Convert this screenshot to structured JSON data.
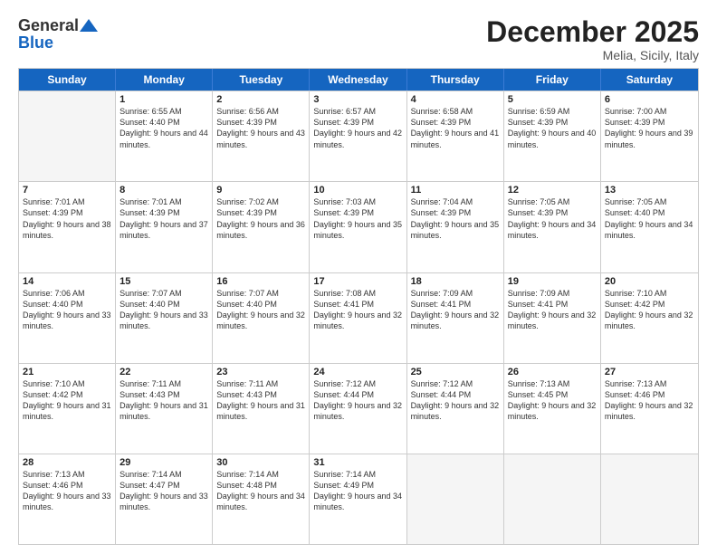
{
  "logo": {
    "line1": "General",
    "line2": "Blue"
  },
  "header": {
    "title": "December 2025",
    "subtitle": "Melia, Sicily, Italy"
  },
  "weekdays": [
    "Sunday",
    "Monday",
    "Tuesday",
    "Wednesday",
    "Thursday",
    "Friday",
    "Saturday"
  ],
  "rows": [
    [
      {
        "day": "",
        "sunrise": "",
        "sunset": "",
        "daylight": ""
      },
      {
        "day": "1",
        "sunrise": "Sunrise: 6:55 AM",
        "sunset": "Sunset: 4:40 PM",
        "daylight": "Daylight: 9 hours and 44 minutes."
      },
      {
        "day": "2",
        "sunrise": "Sunrise: 6:56 AM",
        "sunset": "Sunset: 4:39 PM",
        "daylight": "Daylight: 9 hours and 43 minutes."
      },
      {
        "day": "3",
        "sunrise": "Sunrise: 6:57 AM",
        "sunset": "Sunset: 4:39 PM",
        "daylight": "Daylight: 9 hours and 42 minutes."
      },
      {
        "day": "4",
        "sunrise": "Sunrise: 6:58 AM",
        "sunset": "Sunset: 4:39 PM",
        "daylight": "Daylight: 9 hours and 41 minutes."
      },
      {
        "day": "5",
        "sunrise": "Sunrise: 6:59 AM",
        "sunset": "Sunset: 4:39 PM",
        "daylight": "Daylight: 9 hours and 40 minutes."
      },
      {
        "day": "6",
        "sunrise": "Sunrise: 7:00 AM",
        "sunset": "Sunset: 4:39 PM",
        "daylight": "Daylight: 9 hours and 39 minutes."
      }
    ],
    [
      {
        "day": "7",
        "sunrise": "Sunrise: 7:01 AM",
        "sunset": "Sunset: 4:39 PM",
        "daylight": "Daylight: 9 hours and 38 minutes."
      },
      {
        "day": "8",
        "sunrise": "Sunrise: 7:01 AM",
        "sunset": "Sunset: 4:39 PM",
        "daylight": "Daylight: 9 hours and 37 minutes."
      },
      {
        "day": "9",
        "sunrise": "Sunrise: 7:02 AM",
        "sunset": "Sunset: 4:39 PM",
        "daylight": "Daylight: 9 hours and 36 minutes."
      },
      {
        "day": "10",
        "sunrise": "Sunrise: 7:03 AM",
        "sunset": "Sunset: 4:39 PM",
        "daylight": "Daylight: 9 hours and 35 minutes."
      },
      {
        "day": "11",
        "sunrise": "Sunrise: 7:04 AM",
        "sunset": "Sunset: 4:39 PM",
        "daylight": "Daylight: 9 hours and 35 minutes."
      },
      {
        "day": "12",
        "sunrise": "Sunrise: 7:05 AM",
        "sunset": "Sunset: 4:39 PM",
        "daylight": "Daylight: 9 hours and 34 minutes."
      },
      {
        "day": "13",
        "sunrise": "Sunrise: 7:05 AM",
        "sunset": "Sunset: 4:40 PM",
        "daylight": "Daylight: 9 hours and 34 minutes."
      }
    ],
    [
      {
        "day": "14",
        "sunrise": "Sunrise: 7:06 AM",
        "sunset": "Sunset: 4:40 PM",
        "daylight": "Daylight: 9 hours and 33 minutes."
      },
      {
        "day": "15",
        "sunrise": "Sunrise: 7:07 AM",
        "sunset": "Sunset: 4:40 PM",
        "daylight": "Daylight: 9 hours and 33 minutes."
      },
      {
        "day": "16",
        "sunrise": "Sunrise: 7:07 AM",
        "sunset": "Sunset: 4:40 PM",
        "daylight": "Daylight: 9 hours and 32 minutes."
      },
      {
        "day": "17",
        "sunrise": "Sunrise: 7:08 AM",
        "sunset": "Sunset: 4:41 PM",
        "daylight": "Daylight: 9 hours and 32 minutes."
      },
      {
        "day": "18",
        "sunrise": "Sunrise: 7:09 AM",
        "sunset": "Sunset: 4:41 PM",
        "daylight": "Daylight: 9 hours and 32 minutes."
      },
      {
        "day": "19",
        "sunrise": "Sunrise: 7:09 AM",
        "sunset": "Sunset: 4:41 PM",
        "daylight": "Daylight: 9 hours and 32 minutes."
      },
      {
        "day": "20",
        "sunrise": "Sunrise: 7:10 AM",
        "sunset": "Sunset: 4:42 PM",
        "daylight": "Daylight: 9 hours and 32 minutes."
      }
    ],
    [
      {
        "day": "21",
        "sunrise": "Sunrise: 7:10 AM",
        "sunset": "Sunset: 4:42 PM",
        "daylight": "Daylight: 9 hours and 31 minutes."
      },
      {
        "day": "22",
        "sunrise": "Sunrise: 7:11 AM",
        "sunset": "Sunset: 4:43 PM",
        "daylight": "Daylight: 9 hours and 31 minutes."
      },
      {
        "day": "23",
        "sunrise": "Sunrise: 7:11 AM",
        "sunset": "Sunset: 4:43 PM",
        "daylight": "Daylight: 9 hours and 31 minutes."
      },
      {
        "day": "24",
        "sunrise": "Sunrise: 7:12 AM",
        "sunset": "Sunset: 4:44 PM",
        "daylight": "Daylight: 9 hours and 32 minutes."
      },
      {
        "day": "25",
        "sunrise": "Sunrise: 7:12 AM",
        "sunset": "Sunset: 4:44 PM",
        "daylight": "Daylight: 9 hours and 32 minutes."
      },
      {
        "day": "26",
        "sunrise": "Sunrise: 7:13 AM",
        "sunset": "Sunset: 4:45 PM",
        "daylight": "Daylight: 9 hours and 32 minutes."
      },
      {
        "day": "27",
        "sunrise": "Sunrise: 7:13 AM",
        "sunset": "Sunset: 4:46 PM",
        "daylight": "Daylight: 9 hours and 32 minutes."
      }
    ],
    [
      {
        "day": "28",
        "sunrise": "Sunrise: 7:13 AM",
        "sunset": "Sunset: 4:46 PM",
        "daylight": "Daylight: 9 hours and 33 minutes."
      },
      {
        "day": "29",
        "sunrise": "Sunrise: 7:14 AM",
        "sunset": "Sunset: 4:47 PM",
        "daylight": "Daylight: 9 hours and 33 minutes."
      },
      {
        "day": "30",
        "sunrise": "Sunrise: 7:14 AM",
        "sunset": "Sunset: 4:48 PM",
        "daylight": "Daylight: 9 hours and 34 minutes."
      },
      {
        "day": "31",
        "sunrise": "Sunrise: 7:14 AM",
        "sunset": "Sunset: 4:49 PM",
        "daylight": "Daylight: 9 hours and 34 minutes."
      },
      {
        "day": "",
        "sunrise": "",
        "sunset": "",
        "daylight": ""
      },
      {
        "day": "",
        "sunrise": "",
        "sunset": "",
        "daylight": ""
      },
      {
        "day": "",
        "sunrise": "",
        "sunset": "",
        "daylight": ""
      }
    ]
  ]
}
